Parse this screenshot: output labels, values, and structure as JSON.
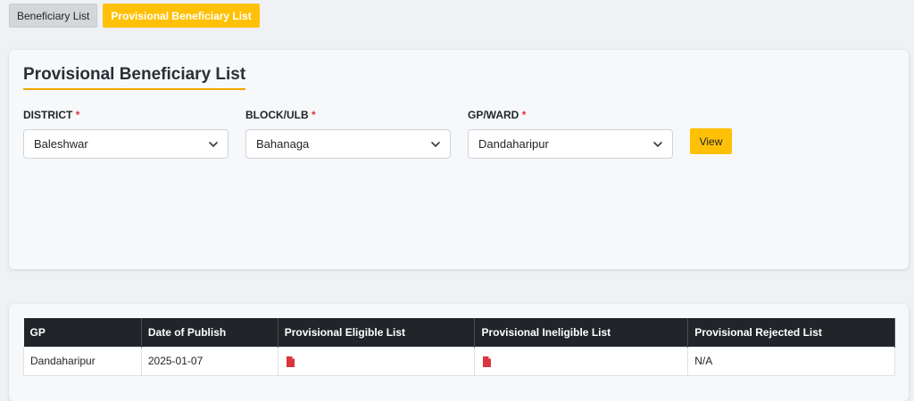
{
  "tabs": [
    {
      "label": "Beneficiary List",
      "active": false
    },
    {
      "label": "Provisional Beneficiary List",
      "active": true
    }
  ],
  "filter": {
    "title": "Provisional Beneficiary List",
    "district": {
      "label": "DISTRICT",
      "value": "Baleshwar"
    },
    "block": {
      "label": "BLOCK/ULB",
      "value": "Bahanaga"
    },
    "gp": {
      "label": "GP/WARD",
      "value": "Dandaharipur"
    },
    "required_marker": "*",
    "view_label": "View"
  },
  "table": {
    "headers": [
      "GP",
      "Date of Publish",
      "Provisional Eligible List",
      "Provisional Ineligible List",
      "Provisional Rejected List"
    ],
    "rows": [
      {
        "gp": "Dandaharipur",
        "date": "2025-01-07",
        "eligible": "pdf-icon",
        "ineligible": "pdf-icon",
        "rejected": "N/A"
      }
    ]
  },
  "colors": {
    "accent": "#ffc107",
    "title_underline": "#f0a500",
    "table_header": "#212529",
    "required": "#dc3545",
    "pdf": "#d9363e"
  }
}
